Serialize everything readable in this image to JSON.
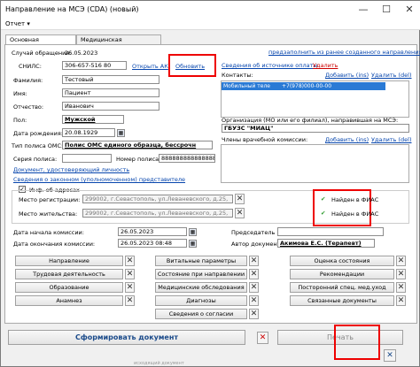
{
  "window": {
    "title": "Направление на МСЭ (CDA) (новый)",
    "minimize": "—",
    "maximize": "☐",
    "close": "✕"
  },
  "menu": {
    "report": "Отчет ▾"
  },
  "tabs": [
    {
      "label": "Основная информация"
    },
    {
      "label": "Медицинская документация"
    }
  ],
  "left": {
    "case_date_label": "Случай обращения:",
    "case_date": "26.05.2023",
    "snils_label": "СНИЛС:",
    "snils": "306-657-516 80",
    "open_ak": "Открыть АК",
    "refresh": "Обновить",
    "last_name_label": "Фамилия:",
    "last_name": "Тестовый",
    "first_name_label": "Имя:",
    "first_name": "Пациент",
    "patronymic_label": "Отчество:",
    "patronymic": "Иванович",
    "sex_label": "Пол:",
    "sex": "Мужской",
    "birth_label": "Дата рождения:",
    "birth": "20.08.1929",
    "policy_type_label": "Тип полиса ОМС:",
    "policy_type": "Полис ОМС единого образца, бессрочн",
    "policy_series_label": "Серия полиса:",
    "policy_number_label": "Номер полиса:",
    "policy_number": "8888888888888888",
    "id_doc_link": "Документ, удостоверяющий личность",
    "legal_rep_link": "Сведения о законном (уполномоченном) представителе"
  },
  "right": {
    "prev_referral_link": "предзаполнить из ранее созданного направления",
    "payer_source_link": "Сведения об источнике оплаты",
    "delete": "Удалить",
    "contacts_label": "Контакты:",
    "add_ins": "Добавить (ins)",
    "delete_del": "Удалить (del)",
    "contact_type": "Мобильный теле",
    "contact_value": "+7(978)000-00-00",
    "org_label": "Организация (МО или его филиал), направившая на МСЭ:",
    "org_value": "ГБУЗС \"МИАЦ\"",
    "commission_label": "Члены врачебной комиссии:"
  },
  "address": {
    "checkbox_label": "Инф. об адресах",
    "checkbox_mark": "✓",
    "reg_label": "Место регистрации:",
    "reg_value": "299002, г.Севастополь, ул.Леваневского, д.25,",
    "res_label": "Место жительства:",
    "res_value": "299002, г.Севастополь, ул.Леваневского, д.25,",
    "fias_found_1": "Найден в ФИАС",
    "fias_found_2": "Найден в ФИАС",
    "fias_mark": "✔"
  },
  "commission": {
    "start_label": "Дата начала комиссии:",
    "start_value": "26.05.2023",
    "end_label": "Дата окончания комиссии:",
    "end_value": "26.05.2023 08:48",
    "chair_label": "Председатель ВК:",
    "author_label": "Автор документа:",
    "author_value": "Акимова Е.С. (Терапевт)"
  },
  "sections": {
    "col1": [
      "Направление",
      "Трудовая деятельность",
      "Образование",
      "Анамнез"
    ],
    "col2": [
      "Витальные параметры",
      "Состояние при направлении",
      "Медицинские обследования",
      "Диагнозы",
      "Сведения о согласии"
    ],
    "col3": [
      "Оценка состояния",
      "Рекомендации",
      "Посторонний спец. мед.уход",
      "Связанные документы"
    ],
    "x_mark": "✕"
  },
  "footer": {
    "generate": "Сформировать документ",
    "print": "Печать",
    "close_icon": "✕",
    "partial_text": "исходящий документ"
  }
}
